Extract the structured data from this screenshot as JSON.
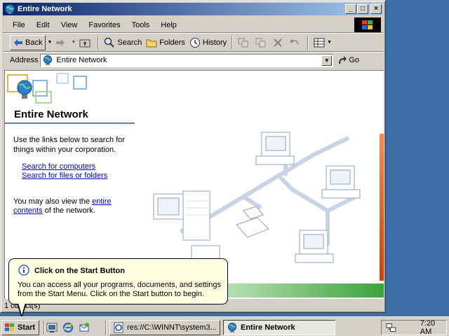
{
  "window": {
    "title": "Entire Network",
    "icon": "globe-icon"
  },
  "menu": [
    "File",
    "Edit",
    "View",
    "Favorites",
    "Tools",
    "Help"
  ],
  "toolbar": {
    "back_label": "Back",
    "search_label": "Search",
    "folders_label": "Folders",
    "history_label": "History"
  },
  "address": {
    "label": "Address",
    "value": "Entire Network",
    "go_label": "Go"
  },
  "content": {
    "title": "Entire Network",
    "intro": "Use the links below to search for things within your corporation.",
    "link_computers": "Search for computers",
    "link_files": "Search for files or folders",
    "also_prefix": "You may also view the",
    "also_link": "entire contents",
    "also_suffix": "of the network."
  },
  "status": {
    "text": "1 object(s)"
  },
  "balloon": {
    "title": "Click on the Start Button",
    "body": "You can access all your programs, documents, and settings from the Start Menu. Click on the Start button to begin."
  },
  "taskbar": {
    "start_label": "Start",
    "task1_label": "res://C:\\WINNT\\system3...",
    "task2_label": "Entire Network",
    "clock": "7:20 AM"
  },
  "colors": {
    "desktop": "#3a6ea5",
    "title_gradient_start": "#0a246a",
    "title_gradient_end": "#a6caf0",
    "link": "#0000cc",
    "balloon_bg": "#ffffe1"
  }
}
